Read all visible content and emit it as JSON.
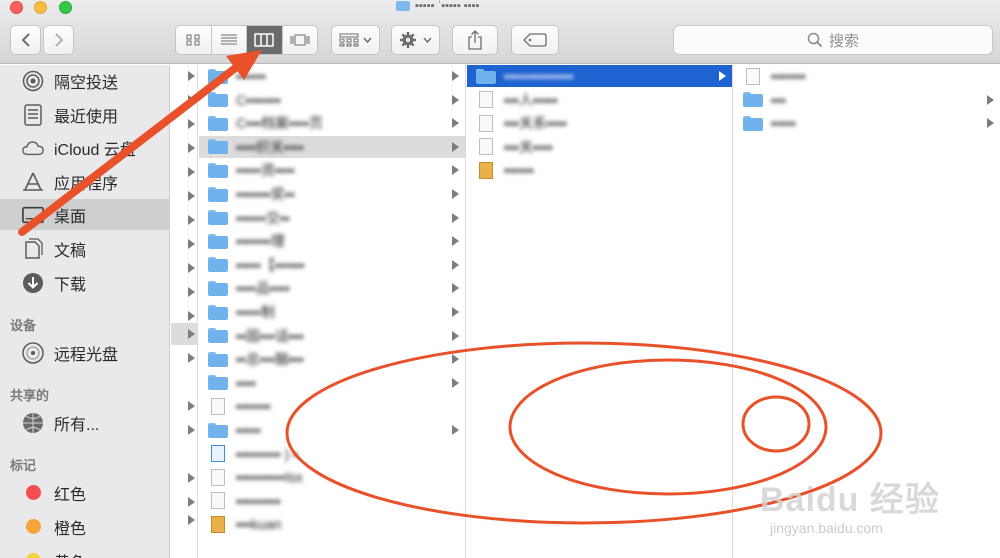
{
  "window": {
    "title": "▪▪▪▪▪ ˈ▪▪▪▪▪ ▪▪▪▪"
  },
  "toolbar": {
    "back_label": "‹",
    "forward_label": "›",
    "search_placeholder": "搜索",
    "view_modes": [
      "icon",
      "list",
      "column",
      "gallery"
    ],
    "active_view": "column"
  },
  "sidebar": {
    "favorites": [
      {
        "label": "隔空投送",
        "icon": "airdrop-icon"
      },
      {
        "label": "最近使用",
        "icon": "recents-icon"
      },
      {
        "label": "iCloud 云盘",
        "icon": "icloud-icon"
      },
      {
        "label": "应用程序",
        "icon": "applications-icon"
      },
      {
        "label": "桌面",
        "icon": "desktop-icon",
        "selected": true
      },
      {
        "label": "文稿",
        "icon": "documents-icon"
      },
      {
        "label": "下载",
        "icon": "downloads-icon"
      }
    ],
    "devices_header": "设备",
    "devices": [
      {
        "label": "远程光盘",
        "icon": "remote-disc-icon"
      }
    ],
    "shared_header": "共享的",
    "shared": [
      {
        "label": "所有...",
        "icon": "network-icon"
      }
    ],
    "tags_header": "标记",
    "tags": [
      {
        "label": "红色",
        "color": "#f25050"
      },
      {
        "label": "橙色",
        "color": "#f5a53a"
      },
      {
        "label": "黄色",
        "color": "#f6d33b"
      }
    ]
  },
  "columns": {
    "col2": [
      {
        "name": "▪▪▪▪▪▪",
        "type": "folder",
        "arrow": true
      },
      {
        "name": "C▪▪▪▪▪▪▪",
        "type": "folder",
        "arrow": true
      },
      {
        "name": "C▪▪▪档案▪▪▪▪页",
        "type": "folder",
        "arrow": true
      },
      {
        "name": "▪▪▪▪织关▪▪▪▪",
        "type": "folder",
        "arrow": true,
        "selected": true
      },
      {
        "name": "▪▪▪▪▪资▪▪▪▪",
        "type": "folder",
        "arrow": true
      },
      {
        "name": "▪▪▪▪▪▪▪奖▪▪",
        "type": "folder",
        "arrow": true
      },
      {
        "name": "▪▪▪▪▪▪交▪▪",
        "type": "folder",
        "arrow": true
      },
      {
        "name": "▪▪▪▪▪▪▪理",
        "type": "folder",
        "arrow": true
      },
      {
        "name": "▪▪▪▪▪【▪▪▪▪▪▪",
        "type": "folder",
        "arrow": true
      },
      {
        "name": "▪▪▪▪品▪▪▪▪",
        "type": "folder",
        "arrow": true
      },
      {
        "name": "▪▪▪▪▪制",
        "type": "folder",
        "arrow": true
      },
      {
        "name": "▪▪固▪▪▪话▪▪▪",
        "type": "folder",
        "arrow": true
      },
      {
        "name": "▪▪总▪▪▪脑▪▪▪",
        "type": "folder",
        "arrow": true
      },
      {
        "name": "▪▪▪▪",
        "type": "folder",
        "arrow": true
      },
      {
        "name": "▪▪▪▪▪▪▪",
        "type": "doc",
        "arrow": false
      },
      {
        "name": "▪▪▪▪▪",
        "type": "folder",
        "arrow": true
      },
      {
        "name": "▪▪▪▪▪▪▪▪▪ ) ▪",
        "type": "sheet",
        "arrow": false
      },
      {
        "name": "▪▪▪▪▪▪▪▪▪▪lsx",
        "type": "doc",
        "arrow": false
      },
      {
        "name": "▪▪▪▪▪▪▪▪▪",
        "type": "doc",
        "arrow": false
      },
      {
        "name": "▪▪▪kuan",
        "type": "img",
        "arrow": false
      }
    ],
    "col3": [
      {
        "name": "▪▪▪▪▪▪▪▪▪▪▪▪▪▪",
        "type": "folder",
        "arrow": true,
        "selected": true
      },
      {
        "name": "▪▪▪人▪▪▪▪▪",
        "type": "doc",
        "arrow": false
      },
      {
        "name": "▪▪▪关系▪▪▪▪",
        "type": "doc",
        "arrow": false
      },
      {
        "name": "▪▪▪关▪▪▪▪",
        "type": "doc",
        "arrow": false
      },
      {
        "name": "▪▪▪▪▪▪",
        "type": "img",
        "arrow": false
      }
    ],
    "col4": [
      {
        "name": "▪▪▪▪▪▪▪",
        "type": "doc",
        "arrow": false
      },
      {
        "name": "▪▪▪",
        "type": "folder",
        "arrow": true
      },
      {
        "name": "▪▪▪▪▪",
        "type": "folder",
        "arrow": true
      }
    ]
  },
  "watermark": {
    "main": "Baidu 经验",
    "sub": "jingyan.baidu.com"
  },
  "annotation_color": "#e8512a"
}
